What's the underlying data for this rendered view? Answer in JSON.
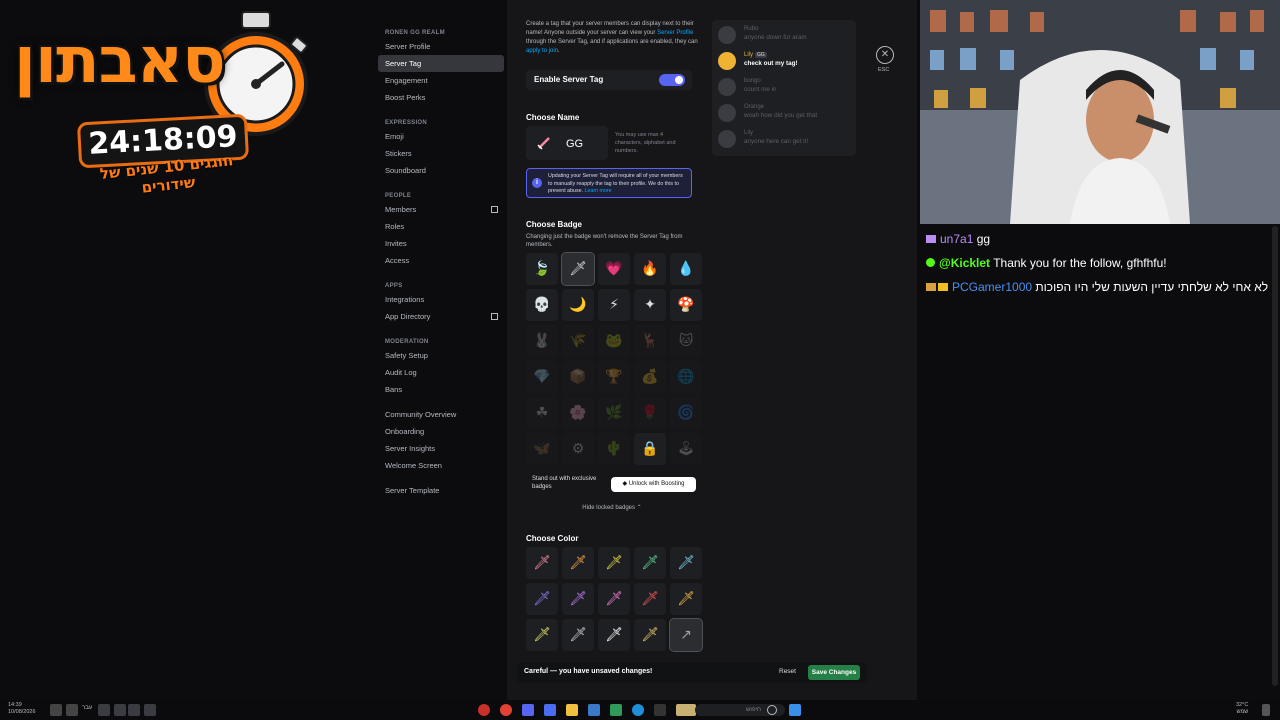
{
  "overlay": {
    "title": "סאבתון",
    "timer": "24:18:09",
    "subtitle": "חוגגים 10 שנים של שידורים"
  },
  "sidebar": {
    "server_name": "RONEN GG REALM",
    "items_top": [
      "Server Profile",
      "Server Tag",
      "Engagement",
      "Boost Perks"
    ],
    "expression_label": "EXPRESSION",
    "expression_items": [
      "Emoji",
      "Stickers",
      "Soundboard"
    ],
    "people_label": "PEOPLE",
    "people_items": [
      "Members",
      "Roles",
      "Invites",
      "Access"
    ],
    "apps_label": "APPS",
    "apps_items": [
      "Integrations",
      "App Directory"
    ],
    "moderation_label": "MODERATION",
    "moderation_items": [
      "Safety Setup",
      "Audit Log",
      "Bans"
    ],
    "community_items": [
      "Community Overview",
      "Onboarding",
      "Server Insights",
      "Welcome Screen"
    ],
    "template_item": "Server Template"
  },
  "main": {
    "description": {
      "part1": "Create a tag that your server members can display next to their name! Anyone outside your server can view your ",
      "link1": "Server Profile",
      "part2": " through the Server Tag, and if applications are enabled, they can ",
      "link2": "apply to join",
      "part3": "."
    },
    "enable_label": "Enable Server Tag",
    "enable_on": true,
    "choose_name": "Choose Name",
    "tag_name": "GG",
    "name_hint": "You may use max 4 characters, alphabet and numbers.",
    "notice": {
      "text": "Updating your Server Tag will require all of your members to manually reapply the tag to their profile. We do this to prevent abuse. ",
      "link": "Learn more"
    },
    "choose_badge": "Choose Badge",
    "badge_sub": "Changing just the badge won't remove the Server Tag from members.",
    "badges": [
      [
        "🍃",
        "🗡",
        "💗",
        "🔥",
        "💧"
      ],
      [
        "💀",
        "🌙",
        "⚡",
        "✦",
        "🍄"
      ],
      [
        "🐰",
        "🌾",
        "🐸",
        "🦌",
        "🐱"
      ],
      [
        "💎",
        "📦",
        "🏆",
        "💰",
        "🌐"
      ],
      [
        "☘",
        "🌸",
        "🌿",
        "🌹",
        "🌀"
      ],
      [
        "🦋",
        "⚙",
        "🌵",
        "🔒",
        "🕹"
      ]
    ],
    "boost_text": "Stand out with exclusive badges",
    "boost_button": "Unlock with Boosting",
    "hide_locked": "Hide locked badges ⌃",
    "choose_color": "Choose Color",
    "colors": [
      [
        {
          "c": "#f48aa0",
          "g": "🗡"
        },
        {
          "c": "#f2a44a",
          "g": "🗡"
        },
        {
          "c": "#e8d84a",
          "g": "🗡"
        },
        {
          "c": "#5fd49a",
          "g": "🗡"
        },
        {
          "c": "#7ad0e8",
          "g": "🗡"
        }
      ],
      [
        {
          "c": "#8b7cf0",
          "g": "🗡"
        },
        {
          "c": "#c07cf0",
          "g": "🗡"
        },
        {
          "c": "#f07cd6",
          "g": "🗡"
        },
        {
          "c": "#f05a5a",
          "g": "🗡"
        },
        {
          "c": "#f0b84a",
          "g": "🗡"
        }
      ],
      [
        {
          "c": "#e0e070",
          "g": "🗡"
        },
        {
          "c": "#c9ccd6",
          "g": "🗡"
        },
        {
          "c": "#ffffff",
          "g": "🗡"
        },
        {
          "c": "#e8c86a",
          "g": "🗡"
        },
        {
          "c": "#9aa0a8",
          "g": "↗"
        }
      ]
    ],
    "save_bar": {
      "text": "Careful — you have unsaved changes!",
      "reset": "Reset",
      "save": "Save Changes"
    }
  },
  "preview": {
    "messages": [
      {
        "name": "Rubo",
        "text": "anyone down for aram",
        "hl": false
      },
      {
        "name": "Lily",
        "tag": "GG",
        "text": "check out my tag!",
        "hl": true
      },
      {
        "name": "bongo",
        "text": "count me in",
        "hl": false
      },
      {
        "name": "Orange",
        "text": "woah how did you get that",
        "hl": false
      },
      {
        "name": "Lily",
        "text": "anyone here can get it!",
        "hl": false
      }
    ]
  },
  "esc_label": "ESC",
  "chat": [
    {
      "user": "un7a1",
      "text": "gg"
    },
    {
      "user": "@Kicklet",
      "text": "Thank you for the follow, gfhfhfu!"
    },
    {
      "user": "PCGamer1000",
      "text": "לא אחי לא שלחתי עדיין השעות שלי היו הפוכות"
    }
  ],
  "taskbar": {
    "time": "14:39",
    "date": "10/08/2026",
    "search_placeholder": "חיפוש",
    "weather": "32°C",
    "weather_label": "שמש",
    "lang": "עבר"
  },
  "colors": {
    "accent": "#5865f2",
    "save": "#248046",
    "timer_orange": "#ff8a1a",
    "kick_green": "#53fc18"
  }
}
